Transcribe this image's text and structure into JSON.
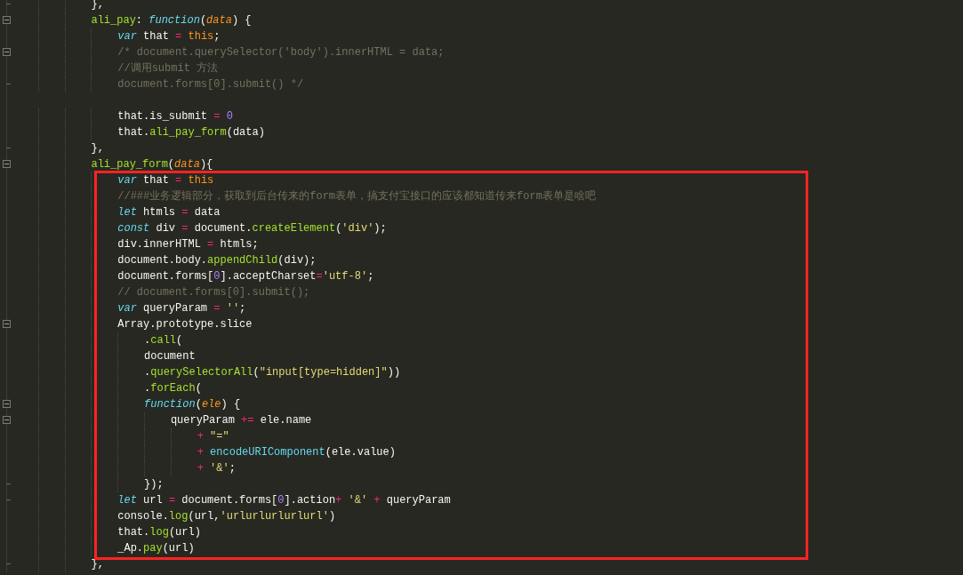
{
  "editor": {
    "lines": [
      {
        "fold_start": false,
        "fold_end": true,
        "highlighted": false,
        "tokens": [
          {
            "kind": "plain",
            "text": "            },"
          }
        ]
      },
      {
        "fold_start": true,
        "fold_end": false,
        "highlighted": false,
        "tokens": [
          {
            "kind": "fn",
            "text": "            ali_pay"
          },
          {
            "kind": "plain",
            "text": ": "
          },
          {
            "kind": "kw",
            "text": "function"
          },
          {
            "kind": "plain",
            "text": "("
          },
          {
            "kind": "param",
            "text": "data"
          },
          {
            "kind": "plain",
            "text": ") {"
          }
        ]
      },
      {
        "fold_start": false,
        "fold_end": false,
        "highlighted": false,
        "tokens": [
          {
            "kind": "kw",
            "text": "                var"
          },
          {
            "kind": "plain",
            "text": " that "
          },
          {
            "kind": "op",
            "text": "= "
          },
          {
            "kind": "this",
            "text": "this"
          },
          {
            "kind": "plain",
            "text": ";"
          }
        ]
      },
      {
        "fold_start": true,
        "fold_end": false,
        "highlighted": false,
        "tokens": [
          {
            "kind": "comment",
            "text": "                /* document.querySelector('body').innerHTML = data;"
          }
        ]
      },
      {
        "fold_start": false,
        "fold_end": false,
        "highlighted": false,
        "tokens": [
          {
            "kind": "comment",
            "text": "                //调用submit 方法"
          }
        ]
      },
      {
        "fold_start": false,
        "fold_end": true,
        "highlighted": false,
        "tokens": [
          {
            "kind": "comment",
            "text": "                document.forms[0].submit() */"
          }
        ]
      },
      {
        "fold_start": false,
        "fold_end": false,
        "highlighted": false
      },
      {
        "fold_start": false,
        "fold_end": false,
        "highlighted": false,
        "tokens": [
          {
            "kind": "plain",
            "text": "                that.is_submit "
          },
          {
            "kind": "op",
            "text": "= "
          },
          {
            "kind": "num",
            "text": "0"
          }
        ]
      },
      {
        "fold_start": false,
        "fold_end": false,
        "highlighted": false,
        "tokens": [
          {
            "kind": "plain",
            "text": "                that."
          },
          {
            "kind": "fn",
            "text": "ali_pay_form"
          },
          {
            "kind": "plain",
            "text": "(data)"
          }
        ]
      },
      {
        "fold_start": false,
        "fold_end": true,
        "highlighted": false,
        "tokens": [
          {
            "kind": "plain",
            "text": "            },"
          }
        ]
      },
      {
        "fold_start": true,
        "fold_end": false,
        "highlighted": false,
        "tokens": [
          {
            "kind": "fn",
            "text": "            ali_pay_form"
          },
          {
            "kind": "plain",
            "text": "("
          },
          {
            "kind": "param",
            "text": "data"
          },
          {
            "kind": "plain",
            "text": "){"
          }
        ]
      },
      {
        "fold_start": false,
        "fold_end": false,
        "highlighted": true,
        "tokens": [
          {
            "kind": "kw",
            "text": "                var"
          },
          {
            "kind": "plain",
            "text": " that "
          },
          {
            "kind": "op",
            "text": "= "
          },
          {
            "kind": "this",
            "text": "this"
          }
        ]
      },
      {
        "fold_start": false,
        "fold_end": false,
        "highlighted": true,
        "tokens": [
          {
            "kind": "comment",
            "text": "                //###业务逻辑部分，获取到后台传来的form表单，搞支付宝接口的应该都知道传来form表单是啥吧"
          }
        ]
      },
      {
        "fold_start": false,
        "fold_end": false,
        "highlighted": true,
        "tokens": [
          {
            "kind": "kw",
            "text": "                let"
          },
          {
            "kind": "plain",
            "text": " htmls "
          },
          {
            "kind": "op",
            "text": "="
          },
          {
            "kind": "plain",
            "text": " data"
          }
        ]
      },
      {
        "fold_start": false,
        "fold_end": false,
        "highlighted": true,
        "tokens": [
          {
            "kind": "kw",
            "text": "                const"
          },
          {
            "kind": "plain",
            "text": " div "
          },
          {
            "kind": "op",
            "text": "="
          },
          {
            "kind": "plain",
            "text": " document."
          },
          {
            "kind": "fn",
            "text": "createElement"
          },
          {
            "kind": "plain",
            "text": "("
          },
          {
            "kind": "str",
            "text": "'div'"
          },
          {
            "kind": "plain",
            "text": ");"
          }
        ]
      },
      {
        "fold_start": false,
        "fold_end": false,
        "highlighted": true,
        "tokens": [
          {
            "kind": "plain",
            "text": "                div.innerHTML "
          },
          {
            "kind": "op",
            "text": "="
          },
          {
            "kind": "plain",
            "text": " htmls;"
          }
        ]
      },
      {
        "fold_start": false,
        "fold_end": false,
        "highlighted": true,
        "tokens": [
          {
            "kind": "plain",
            "text": "                document.body."
          },
          {
            "kind": "fn",
            "text": "appendChild"
          },
          {
            "kind": "plain",
            "text": "(div);"
          }
        ]
      },
      {
        "fold_start": false,
        "fold_end": false,
        "highlighted": true,
        "tokens": [
          {
            "kind": "plain",
            "text": "                document.forms["
          },
          {
            "kind": "num",
            "text": "0"
          },
          {
            "kind": "plain",
            "text": "].acceptCharset"
          },
          {
            "kind": "op",
            "text": "="
          },
          {
            "kind": "str",
            "text": "'utf-8'"
          },
          {
            "kind": "plain",
            "text": ";"
          }
        ]
      },
      {
        "fold_start": false,
        "fold_end": false,
        "highlighted": true,
        "tokens": [
          {
            "kind": "comment",
            "text": "                // document.forms[0].submit();"
          }
        ]
      },
      {
        "fold_start": false,
        "fold_end": false,
        "highlighted": true,
        "tokens": [
          {
            "kind": "kw",
            "text": "                var"
          },
          {
            "kind": "plain",
            "text": " queryParam "
          },
          {
            "kind": "op",
            "text": "= "
          },
          {
            "kind": "str",
            "text": "''"
          },
          {
            "kind": "plain",
            "text": ";"
          }
        ]
      },
      {
        "fold_start": true,
        "fold_end": false,
        "highlighted": true,
        "tokens": [
          {
            "kind": "plain",
            "text": "                Array.prototype.slice"
          }
        ]
      },
      {
        "fold_start": false,
        "fold_end": false,
        "highlighted": true,
        "tokens": [
          {
            "kind": "plain",
            "text": "                    ."
          },
          {
            "kind": "fn",
            "text": "call"
          },
          {
            "kind": "plain",
            "text": "("
          }
        ]
      },
      {
        "fold_start": false,
        "fold_end": false,
        "highlighted": true,
        "tokens": [
          {
            "kind": "plain",
            "text": "                    document"
          }
        ]
      },
      {
        "fold_start": false,
        "fold_end": false,
        "highlighted": true,
        "tokens": [
          {
            "kind": "plain",
            "text": "                    ."
          },
          {
            "kind": "fn",
            "text": "querySelectorAll"
          },
          {
            "kind": "plain",
            "text": "("
          },
          {
            "kind": "str",
            "text": "\"input[type=hidden]\""
          },
          {
            "kind": "plain",
            "text": "))"
          }
        ]
      },
      {
        "fold_start": false,
        "fold_end": false,
        "highlighted": true,
        "tokens": [
          {
            "kind": "plain",
            "text": "                    ."
          },
          {
            "kind": "fn",
            "text": "forEach"
          },
          {
            "kind": "plain",
            "text": "("
          }
        ]
      },
      {
        "fold_start": true,
        "fold_end": false,
        "highlighted": true,
        "tokens": [
          {
            "kind": "kw",
            "text": "                    function"
          },
          {
            "kind": "plain",
            "text": "("
          },
          {
            "kind": "param",
            "text": "ele"
          },
          {
            "kind": "plain",
            "text": ") {"
          }
        ]
      },
      {
        "fold_start": true,
        "fold_end": false,
        "highlighted": true,
        "tokens": [
          {
            "kind": "plain",
            "text": "                        queryParam "
          },
          {
            "kind": "op",
            "text": "+="
          },
          {
            "kind": "plain",
            "text": " ele.name"
          }
        ]
      },
      {
        "fold_start": false,
        "fold_end": false,
        "highlighted": true,
        "tokens": [
          {
            "kind": "op",
            "text": "                            + "
          },
          {
            "kind": "str",
            "text": "\"=\""
          }
        ]
      },
      {
        "fold_start": false,
        "fold_end": false,
        "highlighted": true,
        "tokens": [
          {
            "kind": "op",
            "text": "                            + "
          },
          {
            "kind": "builtin",
            "text": "encodeURIComponent"
          },
          {
            "kind": "plain",
            "text": "(ele.value)"
          }
        ]
      },
      {
        "fold_start": false,
        "fold_end": false,
        "highlighted": true,
        "tokens": [
          {
            "kind": "op",
            "text": "                            + "
          },
          {
            "kind": "str",
            "text": "'&'"
          },
          {
            "kind": "plain",
            "text": ";"
          }
        ]
      },
      {
        "fold_start": false,
        "fold_end": true,
        "highlighted": true,
        "tokens": [
          {
            "kind": "plain",
            "text": "                    });"
          }
        ]
      },
      {
        "fold_start": false,
        "fold_end": true,
        "highlighted": true,
        "tokens": [
          {
            "kind": "kw",
            "text": "                let"
          },
          {
            "kind": "plain",
            "text": " url "
          },
          {
            "kind": "op",
            "text": "="
          },
          {
            "kind": "plain",
            "text": " document.forms["
          },
          {
            "kind": "num",
            "text": "0"
          },
          {
            "kind": "plain",
            "text": "].action"
          },
          {
            "kind": "op",
            "text": "+ "
          },
          {
            "kind": "str",
            "text": "'&'"
          },
          {
            "kind": "op",
            "text": " + "
          },
          {
            "kind": "plain",
            "text": "queryParam"
          }
        ]
      },
      {
        "fold_start": false,
        "fold_end": false,
        "highlighted": true,
        "tokens": [
          {
            "kind": "plain",
            "text": "                console."
          },
          {
            "kind": "fn",
            "text": "log"
          },
          {
            "kind": "plain",
            "text": "(url,"
          },
          {
            "kind": "str",
            "text": "'urlurlurlurlurl'"
          },
          {
            "kind": "plain",
            "text": ")"
          }
        ]
      },
      {
        "fold_start": false,
        "fold_end": false,
        "highlighted": true,
        "tokens": [
          {
            "kind": "plain",
            "text": "                that."
          },
          {
            "kind": "fn",
            "text": "log"
          },
          {
            "kind": "plain",
            "text": "(url)"
          }
        ]
      },
      {
        "fold_start": false,
        "fold_end": false,
        "highlighted": true,
        "tokens": [
          {
            "kind": "plain",
            "text": "                _Ap."
          },
          {
            "kind": "fn",
            "text": "pay"
          },
          {
            "kind": "plain",
            "text": "(url)"
          }
        ]
      },
      {
        "fold_start": false,
        "fold_end": true,
        "highlighted": false,
        "tokens": [
          {
            "kind": "plain",
            "text": "            },"
          }
        ]
      }
    ]
  }
}
